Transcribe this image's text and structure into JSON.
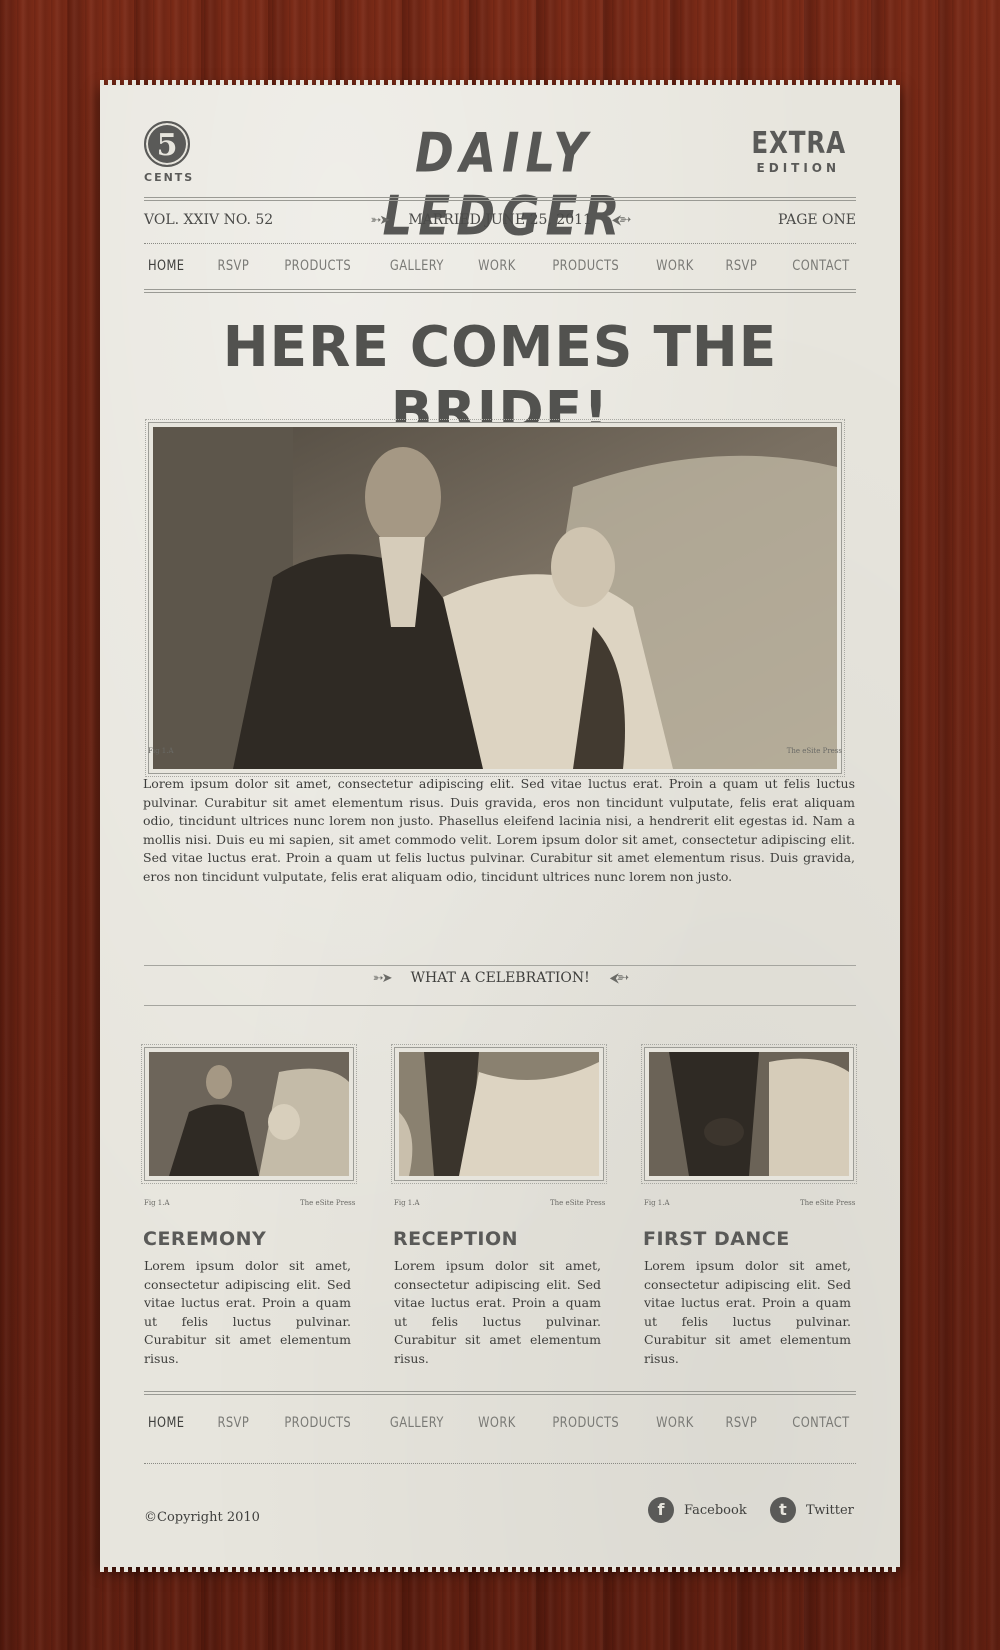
{
  "masthead": {
    "price_number": "5",
    "price_label": "CENTS",
    "title": "DAILY LEDGER",
    "edition_top": "EXTRA",
    "edition_bottom": "EDITION"
  },
  "infobar": {
    "volume": "VOL. XXIV NO. 52",
    "date": "MARRIED JUNE 25, 2011",
    "page": "PAGE ONE",
    "arrow_left": "➳➤",
    "arrow_right": "⮜➳"
  },
  "nav": [
    "HOME",
    "RSVP",
    "PRODUCTS",
    "GALLERY",
    "WORK",
    "PRODUCTS",
    "WORK",
    "RSVP",
    "CONTACT"
  ],
  "headline": "HERE COMES THE BRIDE!",
  "main_photo": {
    "caption_left": "Fig 1.A",
    "caption_right": "The eSite Press"
  },
  "main_text": "Lorem ipsum dolor sit amet, consectetur adipiscing elit. Sed vitae luctus erat. Proin a quam ut felis luctus pulvinar. Curabitur sit amet elementum risus. Duis gravida, eros non tincidunt vulputate, felis erat aliquam odio, tincidunt ultrices nunc lorem non justo. Phasellus eleifend lacinia nisi, a hendrerit elit egestas id. Nam a mollis nisi. Duis eu mi sapien, sit amet commodo velit. Lorem ipsum dolor sit amet, consectetur adipiscing elit. Sed vitae luctus erat. Proin a quam ut felis luctus pulvinar. Curabitur sit amet elementum risus. Duis gravida, eros non tincidunt vulputate, felis erat aliquam odio, tincidunt ultrices nunc lorem non justo.",
  "section": {
    "title": "WHAT A CELEBRATION!"
  },
  "cards": [
    {
      "caption_left": "Fig 1.A",
      "caption_right": "The eSite Press",
      "title": "CEREMONY",
      "text": "Lorem ipsum dolor sit amet, consectetur adipiscing elit. Sed vitae luctus erat. Proin a quam ut felis luctus pulvinar. Curabitur sit amet elementum risus."
    },
    {
      "caption_left": "Fig 1.A",
      "caption_right": "The eSite Press",
      "title": "RECEPTION",
      "text": "Lorem ipsum dolor sit amet, consectetur adipiscing elit. Sed vitae luctus erat. Proin a quam ut felis luctus pulvinar. Curabitur sit amet elementum risus."
    },
    {
      "caption_left": "Fig 1.A",
      "caption_right": "The eSite Press",
      "title": "FIRST DANCE",
      "text": "Lorem ipsum dolor sit amet, consectetur adipiscing elit. Sed vitae luctus erat. Proin a quam ut felis luctus pulvinar. Curabitur sit amet elementum risus."
    }
  ],
  "footer": {
    "copyright": "©Copyright 2010",
    "facebook": "Facebook",
    "facebook_glyph": "f",
    "twitter": "Twitter",
    "twitter_glyph": "t"
  },
  "colors": {
    "paper": "#e7e5dd",
    "ink": "#52524f",
    "wood": "#6b2413"
  }
}
